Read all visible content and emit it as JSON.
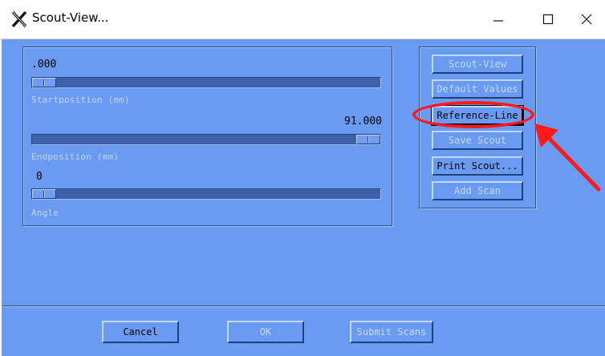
{
  "window": {
    "title": "Scout-View...",
    "icon": "x-logo-icon"
  },
  "scout": {
    "start": {
      "value_label": ".000",
      "caption": "Startposition (mm)",
      "slider_fraction": 0.0
    },
    "end": {
      "value_label": "91.000",
      "caption": "Endposition (mm)",
      "slider_fraction": 1.0
    },
    "angle": {
      "value_label": "0",
      "caption": "Angle",
      "slider_fraction": 0.0
    }
  },
  "side_buttons": {
    "scout_view": "Scout-View",
    "default_values": "Default Values",
    "reference_line": "Reference-Line",
    "save_scout": "Save Scout",
    "print_scout": "Print Scout...",
    "add_scan": "Add Scan"
  },
  "bottom_buttons": {
    "cancel": "Cancel",
    "ok": "OK",
    "submit_scans": "Submit Scans"
  },
  "colors": {
    "background": "#6a9bf3",
    "annotation": "#ff1a1a"
  }
}
